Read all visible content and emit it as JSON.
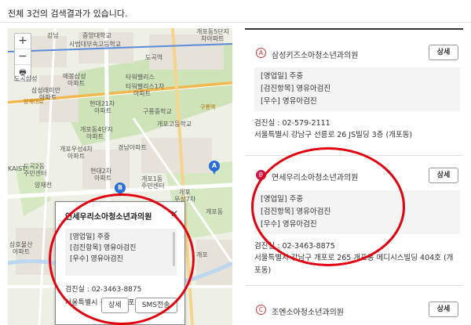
{
  "header": {
    "result_text": "전체 3건의 검색결과가 있습니다."
  },
  "map": {
    "zoom_in": "+",
    "zoom_out": "−",
    "print_icon": "printer-icon",
    "labels": [
      "강남",
      "중앙대학교",
      "사범대부속고등학교",
      "도곡역",
      "개포동5단지",
      "차아파트",
      "매봉삼성",
      "아파트",
      "타워팰리스",
      "타워팰리스1차",
      "아파트",
      "도곡삼성",
      "삼성래미안",
      "아파트",
      "현대21차",
      "아파트",
      "개포동4단지",
      "아파트",
      "개포우성4차",
      "아파트",
      "경남아파트",
      "개포고등학교",
      "구룡중학교",
      "KAIST",
      "도곡2동",
      "주민센터",
      "현대2차",
      "아파트",
      "개포1동",
      "주민센터",
      "개포",
      "우성7차",
      "양재천",
      "삼호물산",
      "아파트",
      "개포",
      "개포동"
    ],
    "road_labels": [
      "구룡역",
      "양재대로"
    ],
    "marker_a": "A",
    "marker_b": "B",
    "popup": {
      "title": "연세우리소아청소년과의원",
      "close": "✕",
      "lines": [
        "[영업일] 주중",
        "[검진항목] 영유아검진",
        "[우수] 영유아검진"
      ],
      "phone": "검진실 : 02-3463-8875",
      "address": "서울특별시 강남구 개포로 265 개",
      "detail_button": "상세",
      "sms_button": "SMS전송"
    }
  },
  "results": [
    {
      "badge": "A",
      "name": "삼성키즈소아청소년과의원",
      "detail_button": "상세",
      "lines": [
        "[영업일] 주중",
        "[검진항목] 영유아검진",
        "[우수] 영유아검진"
      ],
      "phone": "검진실 :  02-579-2111",
      "address": "서울특별시 강남구 선릉로 26 JS빌딩 3층 (개포동)"
    },
    {
      "badge": "B",
      "name": "연세우리소아청소년과의원",
      "detail_button": "상세",
      "lines": [
        "[영업일] 주중",
        "[검진항목] 영유아검진",
        "[우수] 영유아검진"
      ],
      "phone": "검진실 :  02-3463-8875",
      "address": "서울특별시 강남구 개포로 265 개포동 메디시스빌딩 404호 (개포동)"
    },
    {
      "badge": "C",
      "name": "조엔소아청소년과의원",
      "detail_button": "상세"
    }
  ],
  "colors": {
    "annotation": "#e3000f",
    "marker": "#2a6dd8",
    "active_badge": "#d0174a",
    "badge_outline": "#dd3333"
  }
}
